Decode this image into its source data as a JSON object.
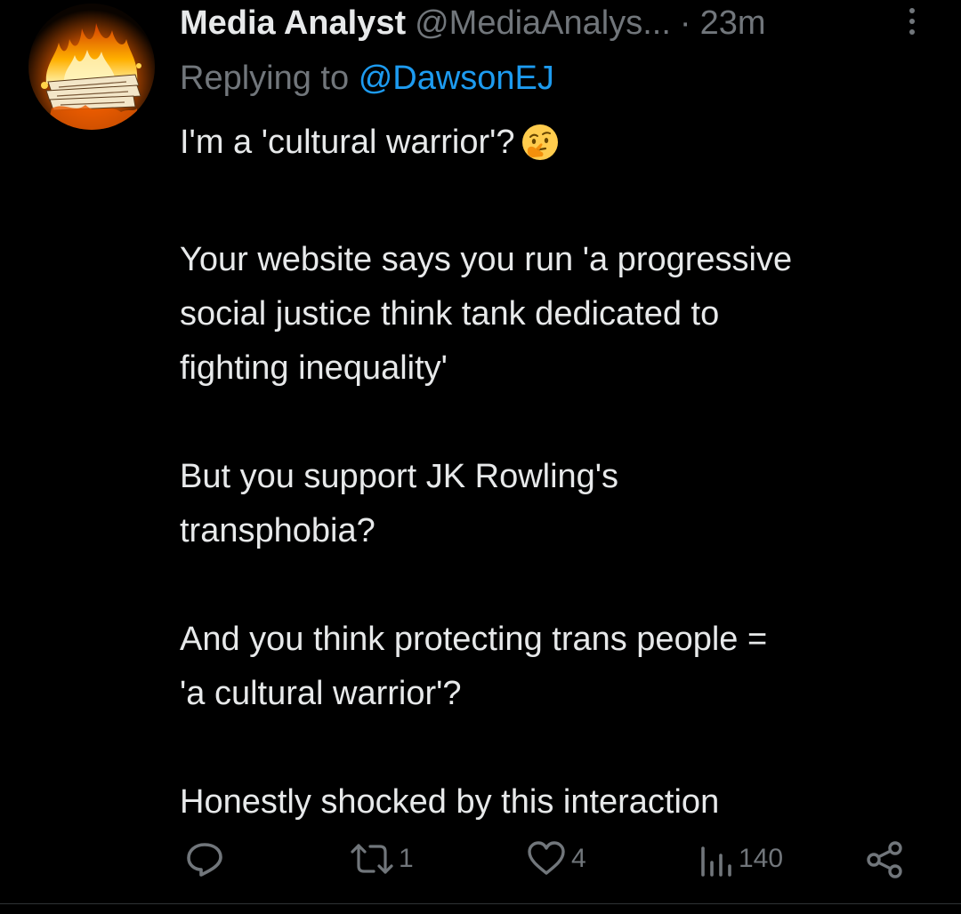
{
  "tweet": {
    "author_name": "Media Analyst",
    "handle": "@MediaAnalys...",
    "separator": "·",
    "time": "23m",
    "replying_prefix": "Replying to",
    "replying_handle": "@DawsonEJ",
    "paragraphs": [
      "I'm a 'cultural warrior'?",
      "Your website says you run 'a progressive social justice think tank dedicated to fighting inequality'",
      "But you support JK Rowling's transphobia?",
      "And you think protecting trans people = 'a cultural warrior'?",
      "Honestly shocked by this interaction"
    ],
    "lines": {
      "p1": "I'm a 'cultural warrior'?",
      "p2_l1": "Your website says you run 'a progressive",
      "p2_l2": "social justice think tank dedicated to",
      "p2_l3": "fighting inequality'",
      "p3_l1": "But you support JK Rowling's",
      "p3_l2": "transphobia?",
      "p4_l1": "And you think protecting trans people =",
      "p4_l2": "'a cultural warrior'?",
      "p5": "Honestly shocked by this interaction"
    },
    "emoji": "thinking-face-emoji",
    "avatar_icon": "burning-newspapers-avatar"
  },
  "actions": {
    "reply_icon": "reply-icon",
    "retweet_icon": "retweet-icon",
    "retweet_count": "1",
    "like_icon": "heart-icon",
    "like_count": "4",
    "views_icon": "views-icon",
    "views_count": "140",
    "share_icon": "share-icon"
  },
  "colors": {
    "background": "#000000",
    "text_primary": "#e7e9ea",
    "text_secondary": "#71767b",
    "link": "#1d9bf0"
  }
}
